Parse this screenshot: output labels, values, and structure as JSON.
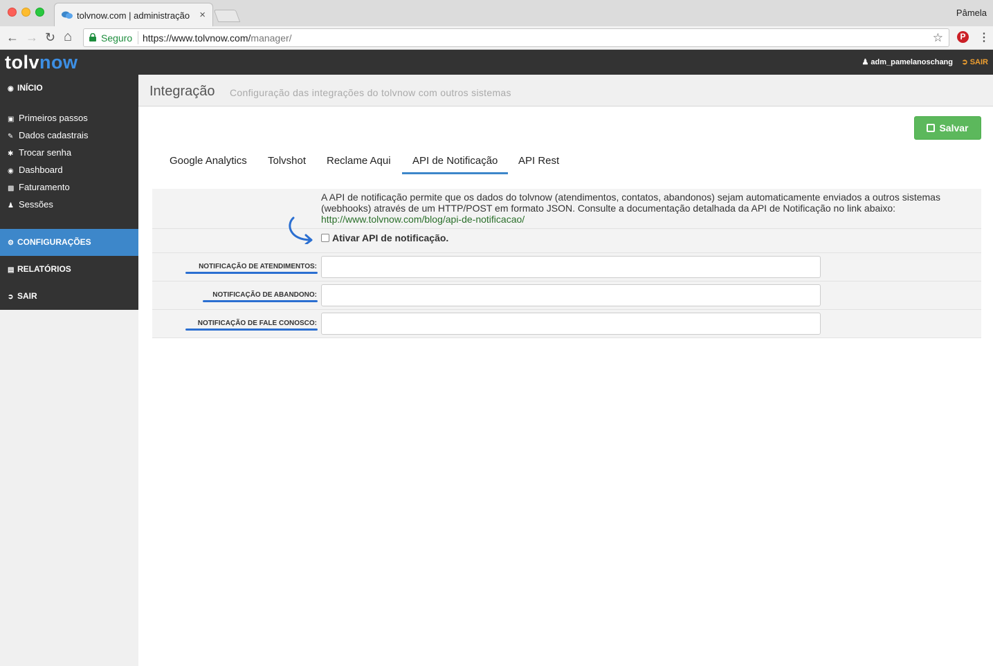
{
  "browser": {
    "tab_title": "tolvnow.com | administração",
    "tab_close": "×",
    "profile_name": "Pâmela",
    "secure_label": "Seguro",
    "url_host": "https://www.tolvnow.com/",
    "url_path": "manager/",
    "nav_back": "←",
    "nav_forward": "→",
    "nav_reload": "↻",
    "nav_home": "⌂",
    "star": "☆",
    "pinterest": "P",
    "menu": "⋮"
  },
  "app": {
    "logo_part1": "tolv",
    "logo_part2": "now",
    "user": "adm_pamelanoschang",
    "logout": "SAIR",
    "accent": "#3d87ca",
    "header_bg": "#333333"
  },
  "sidebar": {
    "inicio": "INÍCIO",
    "sub_items": [
      {
        "label": "Primeiros passos",
        "icon": "briefcase-icon"
      },
      {
        "label": "Dados cadastrais",
        "icon": "edit-icon"
      },
      {
        "label": "Trocar senha",
        "icon": "asterisk-icon"
      },
      {
        "label": "Dashboard",
        "icon": "dashboard-icon"
      },
      {
        "label": "Faturamento",
        "icon": "money-icon"
      },
      {
        "label": "Sessões",
        "icon": "user-icon"
      }
    ],
    "configuracoes": "CONFIGURAÇÕES",
    "relatorios": "RELATÓRIOS",
    "sair": "SAIR"
  },
  "page": {
    "title": "Integração",
    "subtitle": "Configuração das integrações do tolvnow com outros sistemas",
    "save_label": "Salvar",
    "save_color": "#5cb85c"
  },
  "tabs": [
    {
      "label": "Google Analytics",
      "active": false
    },
    {
      "label": "Tolvshot",
      "active": false
    },
    {
      "label": "Reclame Aqui",
      "active": false
    },
    {
      "label": "API de Notificação",
      "active": true
    },
    {
      "label": "API Rest",
      "active": false
    }
  ],
  "form": {
    "description_line1": "A API de notificação permite que os dados do tolvnow (atendimentos, contatos, abandonos) sejam automaticamente enviados a outros sistemas",
    "description_line2": "(webhooks) através de um HTTP/POST em formato JSON. Consulte a documentação detalhada da API de Notificação no link abaixo:",
    "doc_link": "http://www.tolvnow.com/blog/api-de-notificacao/",
    "checkbox_label": "Ativar API de notificação.",
    "checkbox_checked": false,
    "fields": [
      {
        "label": "NOTIFICAÇÃO DE ATENDIMENTOS:",
        "value": ""
      },
      {
        "label": "NOTIFICAÇÃO DE ABANDONO:",
        "value": ""
      },
      {
        "label": "NOTIFICAÇÃO DE FALE CONOSCO:",
        "value": ""
      }
    ],
    "annotation_color": "#2b6fd1"
  }
}
